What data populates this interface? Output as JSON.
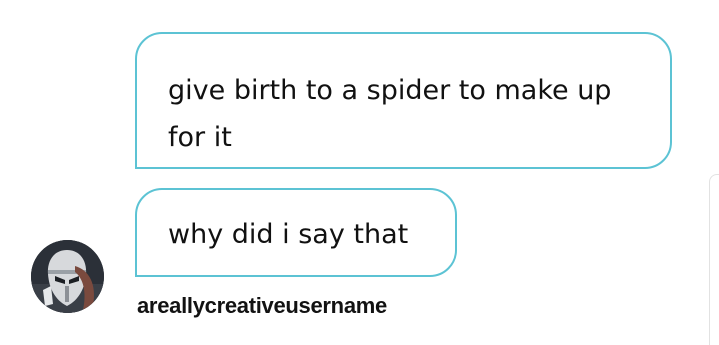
{
  "messages": [
    {
      "text": "give birth to a spider to make up for it"
    },
    {
      "text": "why did i say that"
    }
  ],
  "sender": {
    "username": "areallycreativeusername",
    "avatar_icon": "user-avatar"
  },
  "colors": {
    "bubble_border": "#5cc3d4",
    "text": "#111111",
    "background": "#ffffff"
  }
}
